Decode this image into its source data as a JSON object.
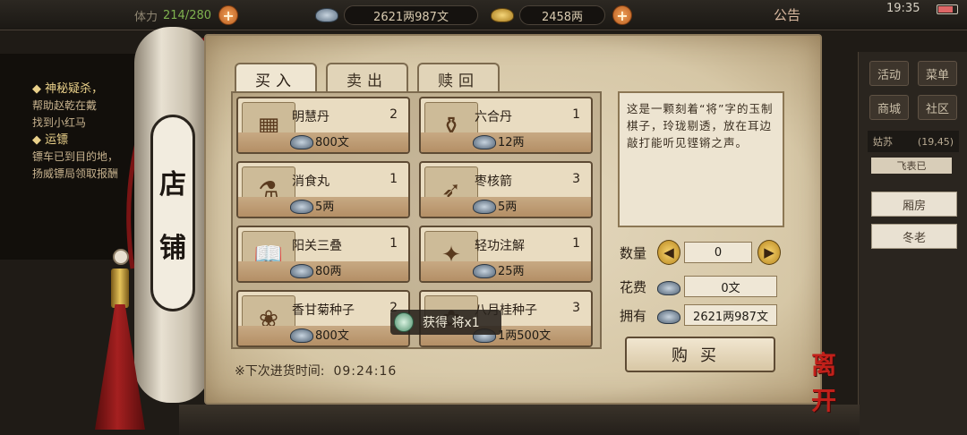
{
  "topbar": {
    "partial_label": "体力",
    "stamina": "214/280",
    "silver": "2621两987文",
    "gold": "2458两",
    "notice": "公告",
    "time": "19:35"
  },
  "quest_panel": {
    "q1_title": "◆ 神秘疑杀，",
    "q1_line1": "帮助赵乾在戴",
    "q1_line2": "找到小红马",
    "q2_title": "◆ 运镖",
    "q2_line1": "镖车已到目的地，",
    "q2_line2": "扬威镖局领取报酬"
  },
  "side_menu": {
    "activity": "活动",
    "menu": "菜单",
    "mall": "商城",
    "community": "社区",
    "location": "姑苏",
    "coords": "(19,45)",
    "sub": "飞表已",
    "room1": "厢房",
    "room2": "冬老"
  },
  "shop": {
    "title_char1": "店",
    "title_char2": "铺",
    "tabs": [
      "买入",
      "卖出",
      "赎回"
    ],
    "items": [
      {
        "name": "明慧丹",
        "qty": "2",
        "price": "800文",
        "icon": "chess-board-icon"
      },
      {
        "name": "六合丹",
        "qty": "1",
        "price": "12两",
        "icon": "wine-gourd-icon"
      },
      {
        "name": "消食丸",
        "qty": "1",
        "price": "5两",
        "icon": "pill-bottle-icon"
      },
      {
        "name": "枣核箭",
        "qty": "3",
        "price": "5两",
        "icon": "arrows-icon"
      },
      {
        "name": "阳关三叠",
        "qty": "1",
        "price": "80两",
        "icon": "book-icon"
      },
      {
        "name": "轻功注解",
        "qty": "1",
        "price": "25两",
        "icon": "scroll-map-icon"
      },
      {
        "name": "香甘菊种子",
        "qty": "2",
        "price": "800文",
        "icon": "seed-box-icon"
      },
      {
        "name": "八月桂种子",
        "qty": "3",
        "price": "1两500文",
        "icon": "seed-pot-icon"
      }
    ],
    "restock_label": "※下次进货时间:",
    "restock_time": "09:24:16",
    "toast": "获得 将x1",
    "description": "这是一颗刻着“将”字的玉制棋子，玲珑剔透，放在耳边敲打能听见铿锵之声。",
    "quantity_label": "数量",
    "quantity_value": "0",
    "cost_label": "花费",
    "cost_value": "0文",
    "owned_label": "拥有",
    "owned_value": "2621两987文",
    "buy_label": "购买",
    "leave_label": "离开"
  },
  "colors": {
    "paper": "#d6c7a6",
    "accent_red": "#c2201a",
    "card_price_bar": "#b48f66"
  }
}
